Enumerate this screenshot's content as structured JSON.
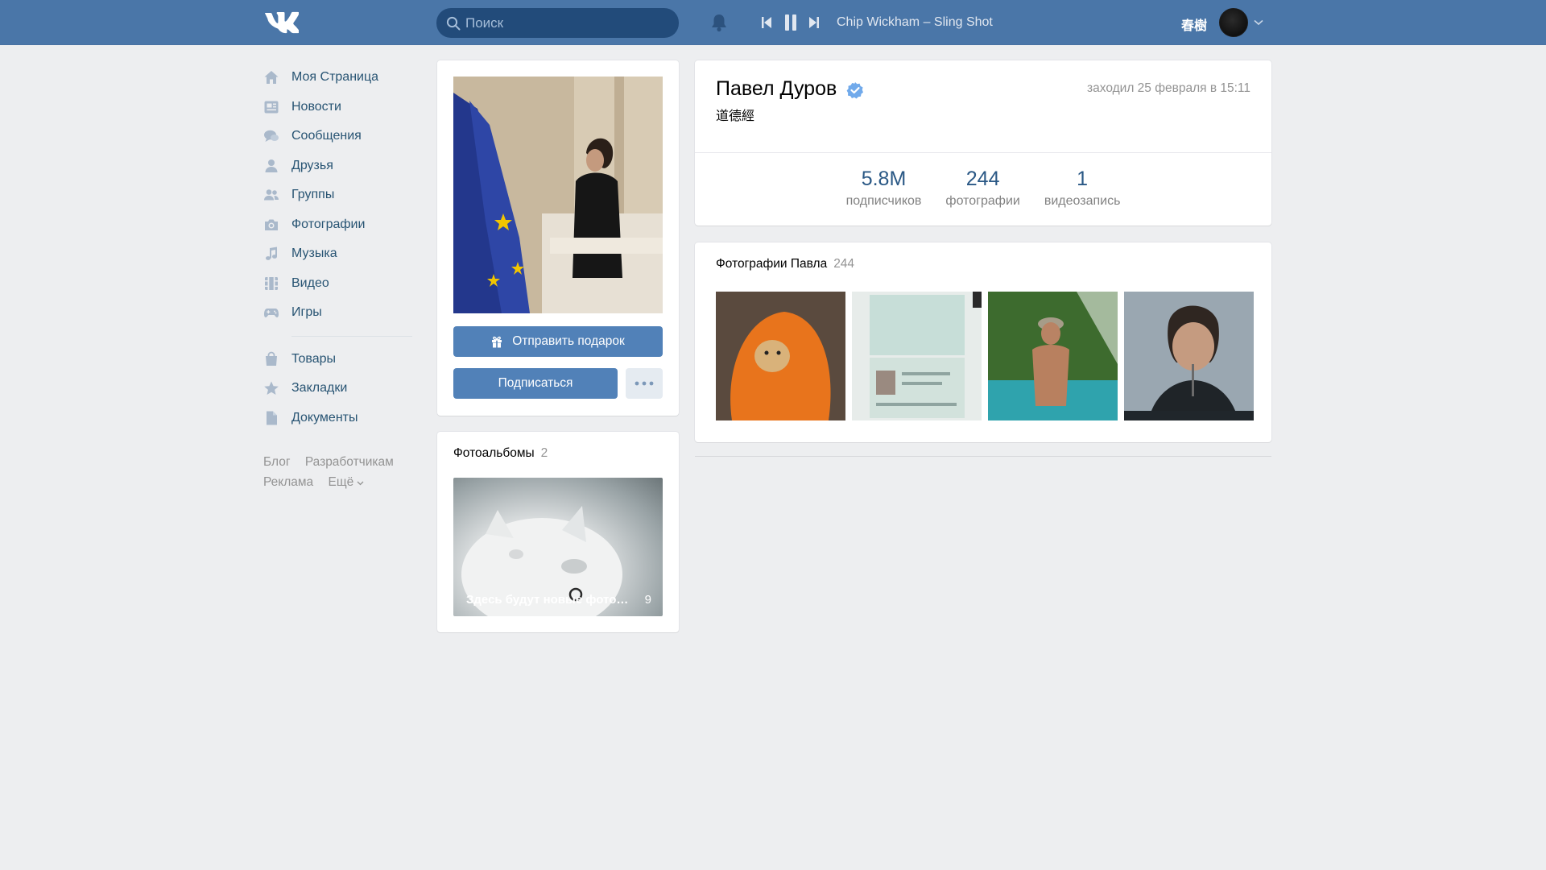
{
  "header": {
    "search_placeholder": "Поиск",
    "now_playing": "Chip Wickham – Sling Shot",
    "user_name": "春樹"
  },
  "sidebar": {
    "items": [
      {
        "label": "Моя Страница",
        "icon": "home-icon"
      },
      {
        "label": "Новости",
        "icon": "news-icon"
      },
      {
        "label": "Сообщения",
        "icon": "messages-icon"
      },
      {
        "label": "Друзья",
        "icon": "friends-icon"
      },
      {
        "label": "Группы",
        "icon": "groups-icon"
      },
      {
        "label": "Фотографии",
        "icon": "camera-icon"
      },
      {
        "label": "Музыка",
        "icon": "music-note-icon"
      },
      {
        "label": "Видео",
        "icon": "video-icon"
      },
      {
        "label": "Игры",
        "icon": "gamepad-icon"
      },
      {
        "label": "Товары",
        "icon": "shopping-bag-icon"
      },
      {
        "label": "Закладки",
        "icon": "star-icon"
      },
      {
        "label": "Документы",
        "icon": "document-icon"
      }
    ],
    "footer": [
      "Блог",
      "Разработчикам",
      "Реклама",
      "Ещё"
    ]
  },
  "profile": {
    "name": "Павел Дуров",
    "status": "道德經",
    "last_seen": "заходил 25 февраля в 15:11",
    "gift_button": "Отправить подарок",
    "subscribe_button": "Подписаться",
    "counters": [
      {
        "value": "5.8M",
        "label": "подписчиков"
      },
      {
        "value": "244",
        "label": "фотографии"
      },
      {
        "value": "1",
        "label": "видеозапись"
      }
    ]
  },
  "albums": {
    "title": "Фотоальбомы",
    "count": "2",
    "items": [
      {
        "title": "Здесь будут новые фотографии",
        "count": "9"
      }
    ]
  },
  "photos": {
    "title": "Фотографии Павла",
    "count": "244"
  },
  "colors": {
    "header_bg": "#4a76a8",
    "accent": "#5181b8",
    "link": "#2a5885",
    "page_bg": "#edeef0"
  }
}
